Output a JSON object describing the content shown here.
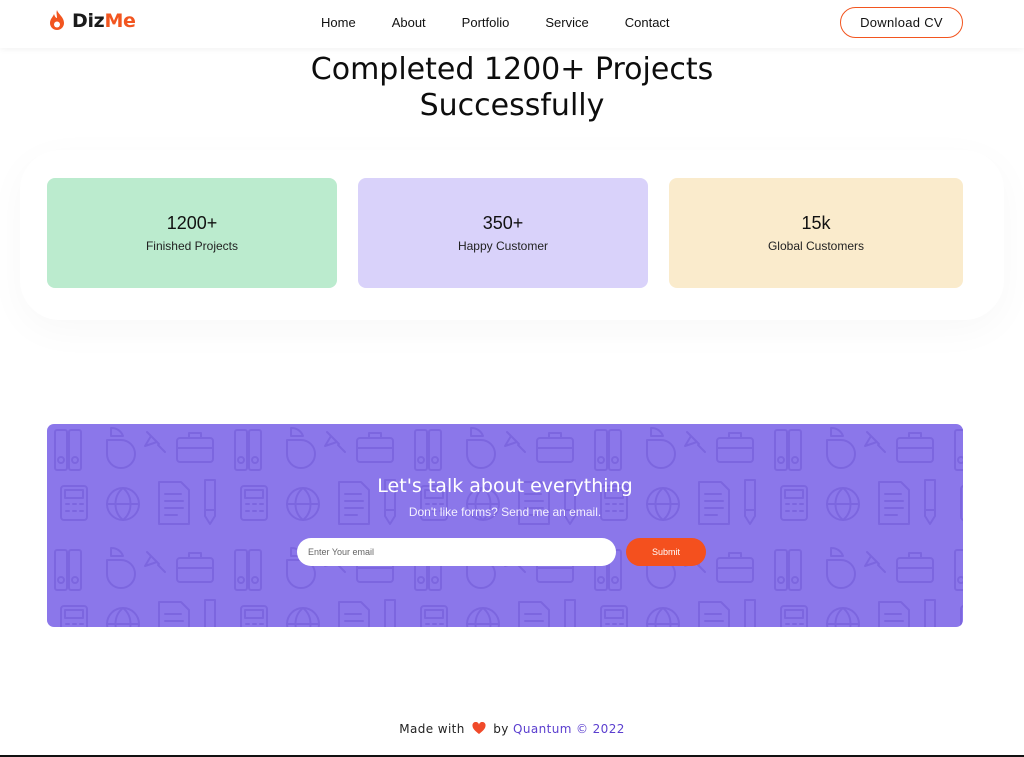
{
  "header": {
    "logo_part1": "Diz",
    "logo_part2": "Me",
    "nav": [
      "Home",
      "About",
      "Portfolio",
      "Service",
      "Contact"
    ],
    "cv_button": "Download CV"
  },
  "headline": {
    "line1": "Completed 1200+ Projects",
    "line2": "Successfully"
  },
  "stats": [
    {
      "value": "1200+",
      "label": "Finished Projects",
      "color": "#bbebce"
    },
    {
      "value": "350+",
      "label": "Happy Customer",
      "color": "#d9d2fa"
    },
    {
      "value": "15k",
      "label": "Global Customers",
      "color": "#faebcc"
    }
  ],
  "contact": {
    "title": "Let's talk about everything",
    "subtitle": "Don't like forms? Send me an email.",
    "email_placeholder": "Enter Your email",
    "submit_label": "Submit",
    "background_color": "#8b77ea",
    "button_color": "#f4501e"
  },
  "footer": {
    "made_with": "Made with",
    "heart_icon": "heart-icon",
    "by": "by",
    "brand": "Quantum",
    "copyright": "© 2022"
  },
  "colors": {
    "accent": "#f2551f"
  }
}
